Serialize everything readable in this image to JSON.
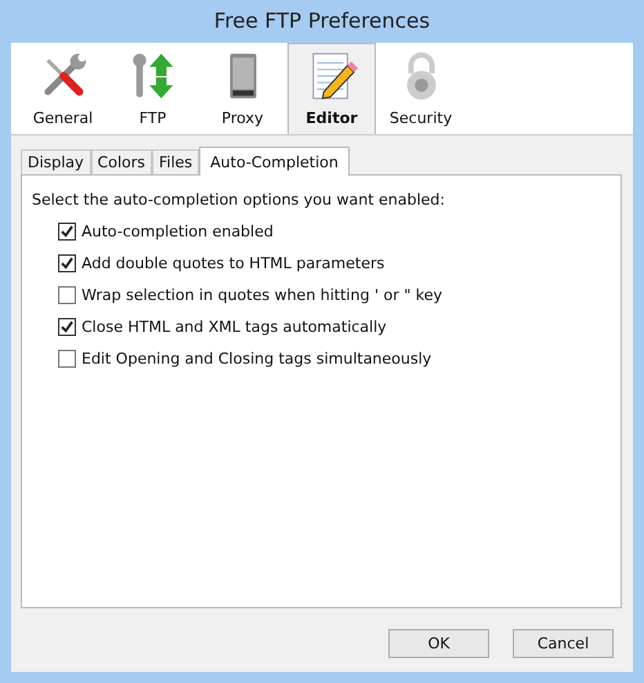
{
  "window": {
    "title": "Free FTP Preferences"
  },
  "toolbar": [
    {
      "label": "General",
      "selected": false
    },
    {
      "label": "FTP",
      "selected": false
    },
    {
      "label": "Proxy",
      "selected": false
    },
    {
      "label": "Editor",
      "selected": true
    },
    {
      "label": "Security",
      "selected": false
    }
  ],
  "tabs": [
    {
      "label": "Display",
      "selected": false
    },
    {
      "label": "Colors",
      "selected": false
    },
    {
      "label": "Files",
      "selected": false
    },
    {
      "label": "Auto-Completion",
      "selected": true
    }
  ],
  "instruction": "Select the auto-completion options you want enabled:",
  "options": [
    {
      "label": "Auto-completion enabled",
      "checked": true
    },
    {
      "label": "Add double quotes to HTML parameters",
      "checked": true
    },
    {
      "label": "Wrap selection in quotes when hitting ' or \" key",
      "checked": false
    },
    {
      "label": "Close HTML and XML tags automatically",
      "checked": true
    },
    {
      "label": "Edit Opening and Closing tags simultaneously",
      "checked": false
    }
  ],
  "buttons": [
    "OK",
    "Cancel"
  ]
}
